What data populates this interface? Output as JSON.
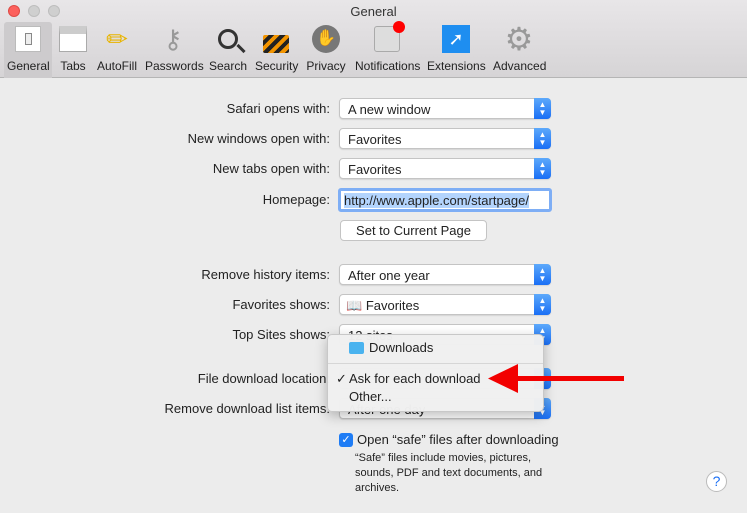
{
  "window": {
    "title": "General"
  },
  "toolbar": [
    {
      "label": "General",
      "icon": "general-switch-icon",
      "selected": true
    },
    {
      "label": "Tabs",
      "icon": "tabs-icon"
    },
    {
      "label": "AutoFill",
      "icon": "pencil-icon"
    },
    {
      "label": "Passwords",
      "icon": "key-icon"
    },
    {
      "label": "Search",
      "icon": "magnifier-icon"
    },
    {
      "label": "Security",
      "icon": "padlock-icon"
    },
    {
      "label": "Privacy",
      "icon": "hand-icon"
    },
    {
      "label": "Notifications",
      "icon": "notification-badge-icon"
    },
    {
      "label": "Extensions",
      "icon": "puzzle-compass-icon"
    },
    {
      "label": "Advanced",
      "icon": "gear-icon"
    }
  ],
  "settings": {
    "safari_opens": {
      "label": "Safari opens with:",
      "value": "A new window"
    },
    "new_windows": {
      "label": "New windows open with:",
      "value": "Favorites"
    },
    "new_tabs": {
      "label": "New tabs open with:",
      "value": "Favorites"
    },
    "homepage": {
      "label": "Homepage:",
      "value": "http://www.apple.com/startpage/"
    },
    "set_current": "Set to Current Page",
    "remove_history": {
      "label": "Remove history items:",
      "value": "After one year"
    },
    "favorites_shows": {
      "label": "Favorites shows:",
      "value": "Favorites"
    },
    "top_sites": {
      "label": "Top Sites shows:",
      "value": "12 sites"
    },
    "download_location": {
      "label": "File download location:"
    },
    "remove_download": {
      "label": "Remove download list items:",
      "value": "After one day"
    },
    "open_safe": {
      "label": "Open “safe” files after downloading",
      "checked": true,
      "note": "“Safe” files include movies, pictures, sounds, PDF and text documents, and archives."
    },
    "help": "?"
  },
  "menu": {
    "items": [
      {
        "label": "Downloads",
        "icon": "downloads-folder-icon"
      },
      {
        "label": "Ask for each download",
        "checked": true,
        "check": "✓"
      },
      {
        "label": "Other..."
      }
    ]
  },
  "colors": {
    "accent": "#1a6ff5",
    "arrow": "#f20000"
  }
}
